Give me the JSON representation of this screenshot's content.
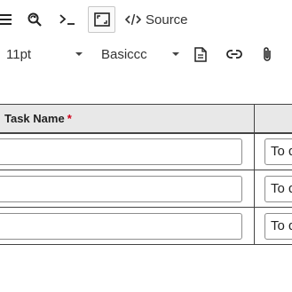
{
  "toolbar": {
    "menu_icon": "menu-icon",
    "search_replace_icon": "search-replace-icon",
    "terminal_icon": "terminal-icon",
    "fullscreen_icon": "fullscreen-icon",
    "source_label": "Source",
    "source_icon": "code-icon"
  },
  "formatting": {
    "font_size": "11pt",
    "font_family": "Basiccc",
    "document_icon": "document-icon",
    "link_icon": "link-icon",
    "attachment_icon": "paperclip-icon"
  },
  "table": {
    "headers": [
      "Task Name",
      ""
    ],
    "required_marker": "*",
    "rows": [
      {
        "task_name": "",
        "status": "To do"
      },
      {
        "task_name": "",
        "status": "To do"
      },
      {
        "task_name": "",
        "status": "To do"
      }
    ]
  }
}
